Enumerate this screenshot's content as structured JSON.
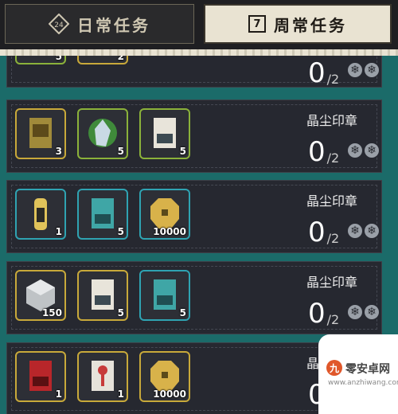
{
  "tabs": {
    "daily": {
      "label": "日常任务",
      "icon_text": "24"
    },
    "weekly": {
      "label": "周常任务",
      "icon_text": "7"
    }
  },
  "rows": [
    {
      "label": "",
      "progress": "0",
      "total": "/2",
      "items": [
        {
          "qty": "5",
          "frame": "green",
          "icon": "document-icon"
        },
        {
          "qty": "2",
          "frame": "gold",
          "icon": "card-icon"
        }
      ]
    },
    {
      "label": "晶尘印章",
      "progress": "0",
      "total": "/2",
      "items": [
        {
          "qty": "3",
          "frame": "gold",
          "icon": "scroll-icon"
        },
        {
          "qty": "5",
          "frame": "green",
          "icon": "crystal-icon"
        },
        {
          "qty": "5",
          "frame": "green",
          "icon": "book-icon"
        }
      ]
    },
    {
      "label": "晶尘印章",
      "progress": "0",
      "total": "/2",
      "items": [
        {
          "qty": "1",
          "frame": "cyan",
          "icon": "bottle-icon"
        },
        {
          "qty": "5",
          "frame": "cyan",
          "icon": "book-icon"
        },
        {
          "qty": "10000",
          "frame": "cyan",
          "icon": "coin-icon"
        }
      ]
    },
    {
      "label": "晶尘印章",
      "progress": "0",
      "total": "/2",
      "items": [
        {
          "qty": "150",
          "frame": "gold",
          "icon": "cube-icon"
        },
        {
          "qty": "5",
          "frame": "gold",
          "icon": "book-icon"
        },
        {
          "qty": "5",
          "frame": "cyan",
          "icon": "book-icon"
        }
      ]
    },
    {
      "label": "晶尘",
      "progress": "0",
      "total": "",
      "items": [
        {
          "qty": "1",
          "frame": "gold",
          "icon": "book-icon"
        },
        {
          "qty": "1",
          "frame": "gold",
          "icon": "key-icon"
        },
        {
          "qty": "10000",
          "frame": "gold",
          "icon": "coin-icon"
        }
      ]
    }
  ],
  "watermark": {
    "logo": "九",
    "text": "零安卓网",
    "sub": "www.anzhiwang.com"
  },
  "colors": {
    "gold": "#c8a93a",
    "green": "#8bb23a",
    "cyan": "#2fa3b2",
    "teal_bg": "#1b6b69",
    "card": "#262830"
  }
}
